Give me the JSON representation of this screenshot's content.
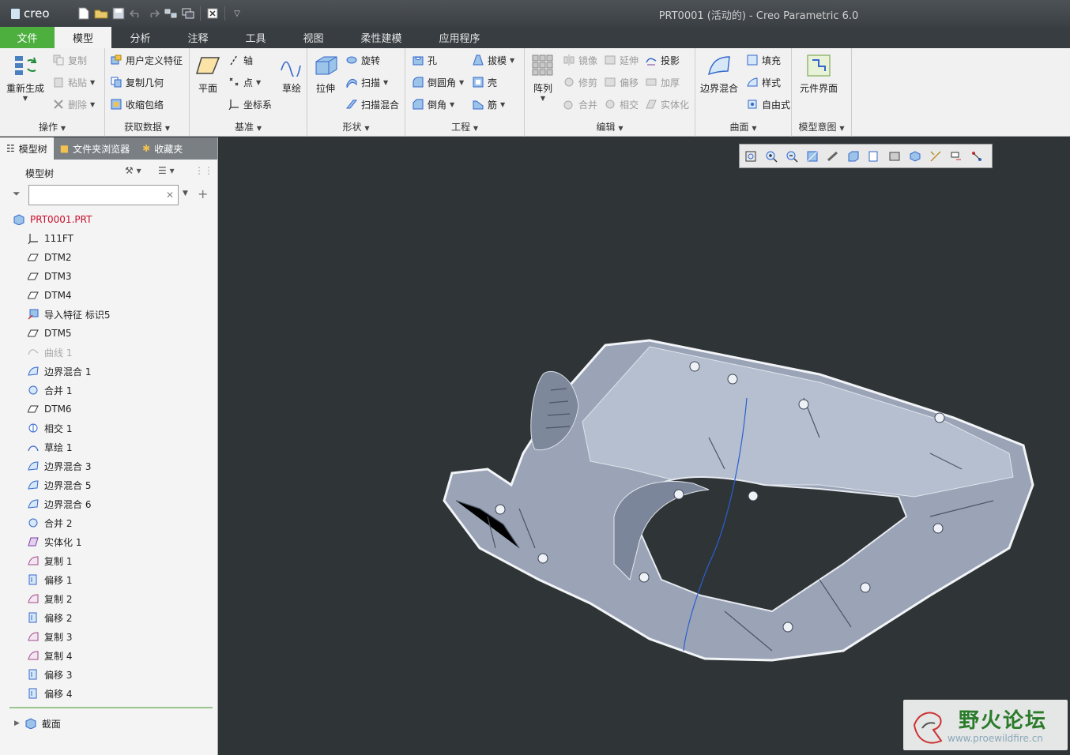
{
  "app": {
    "logo": "creo",
    "window_title": "PRT0001 (活动的) - Creo Parametric 6.0"
  },
  "tabs": [
    "文件",
    "模型",
    "分析",
    "注释",
    "工具",
    "视图",
    "柔性建模",
    "应用程序"
  ],
  "ribbon": {
    "operations": {
      "label": "操作",
      "regen": "重新生成",
      "copy": "复制",
      "paste": "粘贴",
      "delete": "删除"
    },
    "getdata": {
      "label": "获取数据",
      "udf": "用户定义特征",
      "copygeom": "复制几何",
      "shrinkwrap": "收缩包络"
    },
    "datum": {
      "label": "基准",
      "plane": "平面",
      "axis": "轴",
      "point": "点",
      "csys": "坐标系",
      "sketch": "草绘"
    },
    "shapes": {
      "label": "形状",
      "extrude": "拉伸",
      "revolve": "旋转",
      "sweep": "扫描",
      "sweepblend": "扫描混合"
    },
    "engineering": {
      "label": "工程",
      "hole": "孔",
      "round": "倒圆角",
      "chamfer": "倒角",
      "draft": "拔模",
      "shell": "壳",
      "rib": "筋"
    },
    "editing": {
      "label": "编辑",
      "pattern": "阵列",
      "mirror": "镜像",
      "extend": "延伸",
      "project": "投影",
      "trim": "修剪",
      "offset": "偏移",
      "thicken": "加厚",
      "merge": "合并",
      "intersect": "相交",
      "solidify": "实体化"
    },
    "surfaces": {
      "label": "曲面",
      "boundary": "边界混合",
      "fill": "填充",
      "style": "样式",
      "freestyle": "自由式"
    },
    "intent": {
      "label": "模型意图",
      "component": "元件界面"
    }
  },
  "panel": {
    "tabs": [
      "模型树",
      "文件夹浏览器",
      "收藏夹"
    ],
    "header": "模型树",
    "search_value": "",
    "root": "PRT0001.PRT",
    "items": [
      {
        "label": "111FT",
        "icon": "csys-icon",
        "dim": false
      },
      {
        "label": "DTM2",
        "icon": "datum-plane-icon",
        "dim": false
      },
      {
        "label": "DTM3",
        "icon": "datum-plane-icon",
        "dim": false
      },
      {
        "label": "DTM4",
        "icon": "datum-plane-icon",
        "dim": false
      },
      {
        "label": "导入特征 标识5",
        "icon": "import-feature-icon",
        "dim": false
      },
      {
        "label": "DTM5",
        "icon": "datum-plane-icon",
        "dim": false
      },
      {
        "label": "曲线 1",
        "icon": "curve-icon",
        "dim": true
      },
      {
        "label": "边界混合 1",
        "icon": "boundary-blend-icon",
        "dim": false
      },
      {
        "label": "合并 1",
        "icon": "merge-icon",
        "dim": false
      },
      {
        "label": "DTM6",
        "icon": "datum-plane-icon",
        "dim": false
      },
      {
        "label": "相交 1",
        "icon": "intersect-icon",
        "dim": false
      },
      {
        "label": "草绘 1",
        "icon": "sketch-icon",
        "dim": false
      },
      {
        "label": "边界混合 3",
        "icon": "boundary-blend-icon",
        "dim": false
      },
      {
        "label": "边界混合 5",
        "icon": "boundary-blend-icon",
        "dim": false
      },
      {
        "label": "边界混合 6",
        "icon": "boundary-blend-icon",
        "dim": false
      },
      {
        "label": "合并 2",
        "icon": "merge-icon",
        "dim": false
      },
      {
        "label": "实体化 1",
        "icon": "solidify-icon",
        "dim": false
      },
      {
        "label": "复制 1",
        "icon": "copy-surface-icon",
        "dim": false
      },
      {
        "label": "偏移 1",
        "icon": "offset-icon",
        "dim": false
      },
      {
        "label": "复制 2",
        "icon": "copy-surface-icon",
        "dim": false
      },
      {
        "label": "偏移 2",
        "icon": "offset-icon",
        "dim": false
      },
      {
        "label": "复制 3",
        "icon": "copy-surface-icon",
        "dim": false
      },
      {
        "label": "复制 4",
        "icon": "copy-surface-icon",
        "dim": false
      },
      {
        "label": "偏移 3",
        "icon": "offset-icon",
        "dim": false
      },
      {
        "label": "偏移 4",
        "icon": "offset-icon",
        "dim": false
      }
    ],
    "section": "截面"
  },
  "watermark": {
    "title": "野火论坛",
    "url": "www.proewildfire.cn"
  },
  "colors": {
    "accent_green": "#4caf3e",
    "viewport_bg": "#2f3537",
    "part_fill": "#a9b2c2",
    "root_red": "#c8102e"
  }
}
